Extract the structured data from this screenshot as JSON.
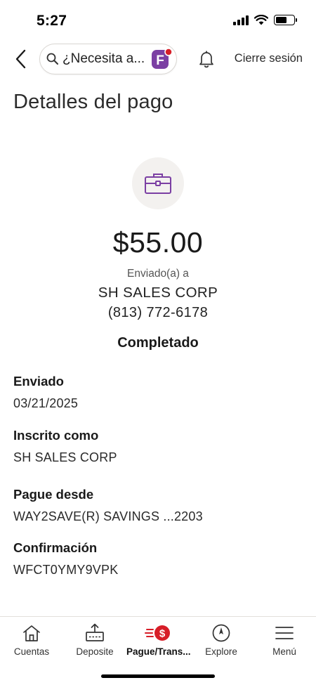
{
  "status_bar": {
    "time": "5:27"
  },
  "header": {
    "search_placeholder": "¿Necesita a...",
    "assistant_badge_letter": "F",
    "logout_label": "Cierre sesión"
  },
  "page": {
    "title": "Detalles del pago"
  },
  "summary": {
    "category_icon": "briefcase-icon",
    "amount": "$55.00",
    "sent_to_label": "Enviado(a) a",
    "payee_name": "SH SALES CORP",
    "payee_phone": "(813) 772-6178",
    "status": "Completado"
  },
  "details": [
    {
      "label": "Enviado",
      "value": "03/21/2025"
    },
    {
      "label": "Inscrito como",
      "value": "SH SALES CORP"
    },
    {
      "label": "Pague desde",
      "value": "WAY2SAVE(R) SAVINGS ...2203"
    },
    {
      "label": "Confirmación",
      "value": "WFCT0YMY9VPK"
    }
  ],
  "bottom_nav": {
    "items": [
      {
        "label": "Cuentas",
        "icon": "home-icon"
      },
      {
        "label": "Deposite",
        "icon": "deposit-icon"
      },
      {
        "label": "Pague/Trans...",
        "icon": "pay-transfer-icon",
        "active": true
      },
      {
        "label": "Explore",
        "icon": "compass-icon"
      },
      {
        "label": "Menú",
        "icon": "menu-icon"
      }
    ]
  },
  "colors": {
    "accent_purple": "#7b3fa3",
    "alert_red": "#d71e28",
    "icon_circle_bg": "#f3f1ef"
  }
}
